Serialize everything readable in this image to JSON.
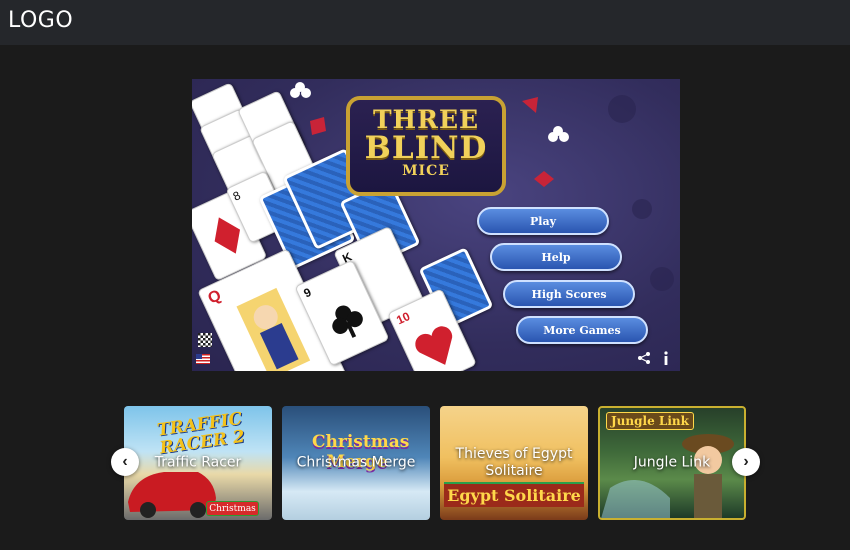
{
  "header": {
    "logo": "LOGO"
  },
  "game": {
    "title_line1": "THREE",
    "title_line2": "BLIND",
    "title_line3": "MICE",
    "menu": [
      {
        "label": "Play"
      },
      {
        "label": "Help"
      },
      {
        "label": "High Scores"
      },
      {
        "label": "More Games"
      }
    ],
    "share_icon": "share-icon",
    "info_icon": "info-icon",
    "card_ranks": [
      "8",
      "Q",
      "K",
      "9",
      "10"
    ]
  },
  "carousel": {
    "prev_icon": "chevron-left-icon",
    "next_icon": "chevron-right-icon",
    "items": [
      {
        "label": "Traffic Racer",
        "art_text": "TRAFFIC RACER 2"
      },
      {
        "label": "Christmas Merge",
        "art_text": "Christmas Merge",
        "badge": "Christmas"
      },
      {
        "label": "Thieves of Egypt Solitaire",
        "art_text": "Egypt Solitaire"
      },
      {
        "label": "Jungle Link",
        "art_text": "Jungle Link"
      }
    ]
  }
}
